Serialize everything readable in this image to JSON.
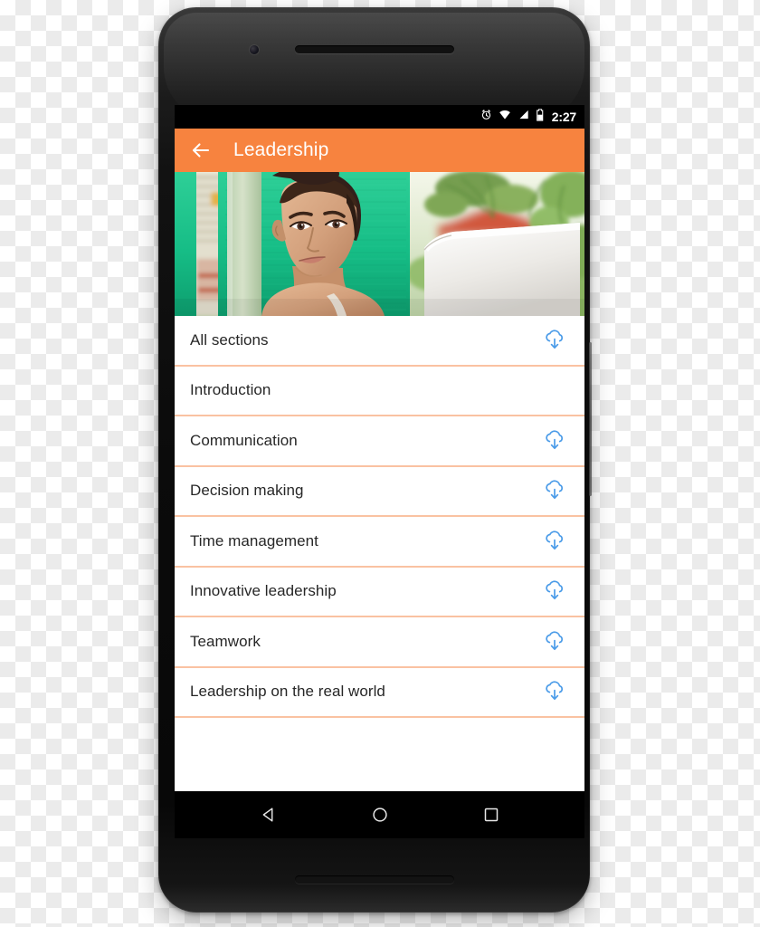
{
  "device": {
    "name": "android-phone",
    "earpiece": "earpiece-speaker",
    "front_camera": "front-camera",
    "bottom_speaker": "bottom-speaker",
    "side_button": "power-button"
  },
  "status_bar": {
    "time": "2:27",
    "icons": [
      {
        "name": "alarm-icon"
      },
      {
        "name": "wifi-icon"
      },
      {
        "name": "cell-signal-icon"
      },
      {
        "name": "battery-icon"
      }
    ],
    "background": "#000000",
    "foreground": "#ffffff"
  },
  "app_bar": {
    "title": "Leadership",
    "back_icon": "back-arrow-icon",
    "background": "#F7833F",
    "text_color": "#ffffff"
  },
  "hero": {
    "alt": "Woman smiling while using a laptop in front of a green textured wall",
    "colors": {
      "wall_green": "#16b783",
      "wall_green_light": "#3fd3a0",
      "skin": "#d7a584",
      "hair": "#3b2317",
      "laptop": "#f2f2f0",
      "foliage": "#8dbb62",
      "sky": "#eef3e6",
      "roof": "#d1593c"
    }
  },
  "list": {
    "divider_color": "#FAC2A2",
    "download_icon_color": "#4A9BE8",
    "download_icon_name": "cloud-download-icon",
    "rows": [
      {
        "label": "All sections",
        "downloadable": true
      },
      {
        "label": "Introduction",
        "downloadable": false
      },
      {
        "label": "Communication",
        "downloadable": true
      },
      {
        "label": "Decision making",
        "downloadable": true
      },
      {
        "label": "Time management",
        "downloadable": true
      },
      {
        "label": "Innovative leadership",
        "downloadable": true
      },
      {
        "label": "Teamwork",
        "downloadable": true
      },
      {
        "label": "Leadership on the real world",
        "downloadable": true
      }
    ]
  },
  "nav_bar": {
    "background": "#000000",
    "keys": [
      {
        "name": "nav-back-key",
        "icon": "triangle-left-icon"
      },
      {
        "name": "nav-home-key",
        "icon": "circle-icon"
      },
      {
        "name": "nav-recents-key",
        "icon": "square-icon"
      }
    ]
  }
}
